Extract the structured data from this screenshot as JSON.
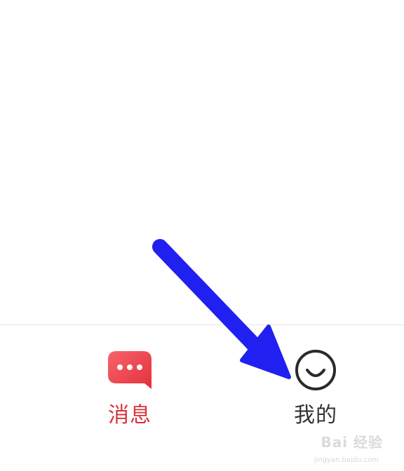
{
  "tabbar": {
    "items": [
      {
        "label": "消息",
        "icon": "chat-bubble-icon",
        "active": true,
        "color": "#d8323b"
      },
      {
        "label": "我的",
        "icon": "smiley-icon",
        "active": false,
        "color": "#333333"
      }
    ]
  },
  "annotation": {
    "arrow_color": "#2020f0"
  },
  "watermark": {
    "brand": "Bai 经验",
    "url": "jingyan.baidu.com"
  }
}
